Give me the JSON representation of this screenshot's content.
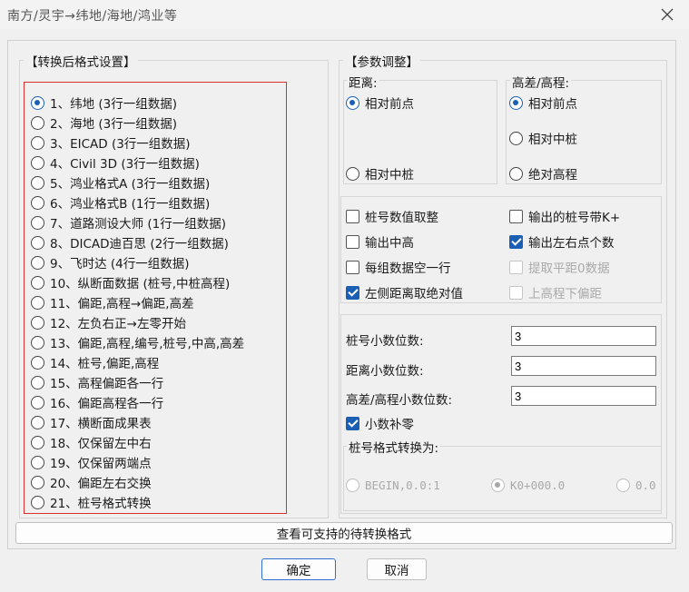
{
  "window": {
    "title": "南方/灵宇→纬地/海地/鸿业等"
  },
  "left": {
    "group_title": "【转换后格式设置】",
    "options": [
      "1、纬地 (3行一组数据)",
      "2、海地 (3行一组数据)",
      "3、EICAD (3行一组数据)",
      "4、Civil 3D (3行一组数据)",
      "5、鸿业格式A (3行一组数据)",
      "6、鸿业格式B (1行一组数据)",
      "7、道路测设大师 (1行一组数据)",
      "8、DICAD迪百思 (2行一组数据)",
      "9、飞时达 (4行一组数据)",
      "10、纵断面数据 (桩号,中桩高程)",
      "11、偏距,高程→偏距,高差",
      "12、左负右正→左零开始",
      "13、偏距,高程,编号,桩号,中高,高差",
      "14、桩号,偏距,高程",
      "15、高程偏距各一行",
      "16、偏距高程各一行",
      "17、横断面成果表",
      "18、仅保留左中右",
      "19、仅保留两端点",
      "20、偏距左右交换",
      "21、桩号格式转换"
    ],
    "selected_index": 0
  },
  "right": {
    "group_title": "【参数调整】",
    "distance": {
      "title": "距离:",
      "options": [
        "相对前点",
        "相对中桩"
      ],
      "selected_index": 0
    },
    "elevation": {
      "title": "高差/高程:",
      "options": [
        "相对前点",
        "相对中桩",
        "绝对高程"
      ],
      "selected_index": 0
    },
    "checkboxes": {
      "round_station": {
        "label": "桩号数值取整",
        "checked": false,
        "enabled": true
      },
      "output_k_plus": {
        "label": "输出的桩号带K+",
        "checked": false,
        "enabled": true
      },
      "output_center_elev": {
        "label": "输出中高",
        "checked": false,
        "enabled": true
      },
      "output_lr_count": {
        "label": "输出左右点个数",
        "checked": true,
        "enabled": true
      },
      "blank_line_per_group": {
        "label": "每组数据空一行",
        "checked": false,
        "enabled": true
      },
      "extract_zero_offset": {
        "label": "提取平距0数据",
        "checked": false,
        "enabled": false
      },
      "left_abs_distance": {
        "label": "左侧距离取绝对值",
        "checked": true,
        "enabled": true
      },
      "upper_elev_lower_offset": {
        "label": "上高程下偏距",
        "checked": false,
        "enabled": false
      }
    },
    "decimals": {
      "station_label": "桩号小数位数:",
      "station_value": "3",
      "distance_label": "距离小数位数:",
      "distance_value": "3",
      "elevation_label": "高差/高程小数位数:",
      "elevation_value": "3",
      "pad_zero_label": "小数补零",
      "pad_zero_checked": true
    },
    "station_format": {
      "title": "桩号格式转换为:",
      "options": [
        "BEGIN,0.0:1",
        "K0+000.0",
        "0.0"
      ],
      "selected_index": 1
    }
  },
  "view_formats_button": "查看可支持的待转换格式",
  "ok_button": "确定",
  "cancel_button": "取消",
  "colors": {
    "accent": "#1a5fb4",
    "highlight_border": "#d9302c"
  }
}
